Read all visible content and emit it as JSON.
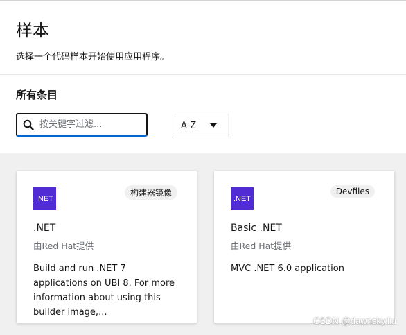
{
  "page": {
    "title": "样本",
    "description": "选择一个代码样本开始使用应用程序。"
  },
  "filter": {
    "section_title": "所有条目",
    "search_placeholder": "按关键字过滤...",
    "sort_value": "A-Z"
  },
  "cards": [
    {
      "logo_text": ".NET",
      "badge": "构建器镜像",
      "title": ".NET",
      "provider": "由Red Hat提供",
      "description": "Build and run .NET 7 applications on UBI 8. For more information about using this builder image,..."
    },
    {
      "logo_text": ".NET",
      "badge": "Devfiles",
      "title": "Basic .NET",
      "provider": "由Red Hat提供",
      "description": "MVC .NET 6.0 application"
    }
  ],
  "watermark": "CSDN @dawnsky.liu",
  "colors": {
    "dotnet_brand": "#512bd4",
    "search_focus": "#0066cc",
    "gallery_bg": "#f0f0f0"
  }
}
